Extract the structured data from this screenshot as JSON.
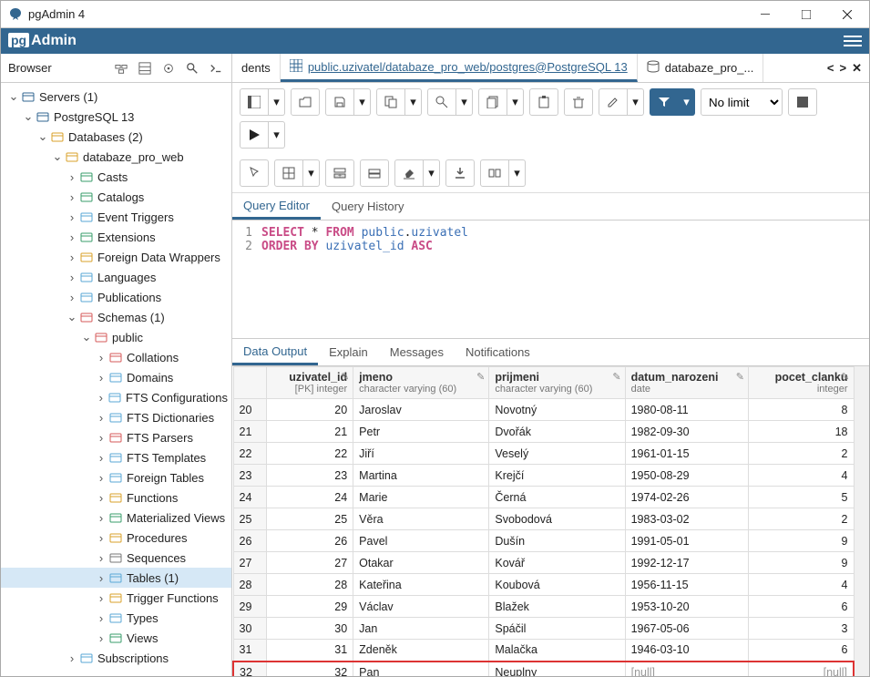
{
  "window": {
    "title": "pgAdmin 4"
  },
  "logo": {
    "box": "pg",
    "text": "Admin"
  },
  "browser": {
    "label": "Browser",
    "tree": [
      {
        "depth": 0,
        "caret": "down",
        "icon": "server-group",
        "color": "#326690",
        "label": "Servers (1)"
      },
      {
        "depth": 1,
        "caret": "down",
        "icon": "pg-elephant",
        "color": "#326690",
        "label": "PostgreSQL 13"
      },
      {
        "depth": 2,
        "caret": "down",
        "icon": "database-stack",
        "color": "#d9a02a",
        "label": "Databases (2)"
      },
      {
        "depth": 3,
        "caret": "down",
        "icon": "database",
        "color": "#d9a02a",
        "label": "databaze_pro_web"
      },
      {
        "depth": 4,
        "caret": "right",
        "icon": "casts",
        "color": "#3a9e6b",
        "label": "Casts"
      },
      {
        "depth": 4,
        "caret": "right",
        "icon": "catalogs",
        "color": "#3a9e6b",
        "label": "Catalogs"
      },
      {
        "depth": 4,
        "caret": "right",
        "icon": "event-triggers",
        "color": "#5aa7d6",
        "label": "Event Triggers"
      },
      {
        "depth": 4,
        "caret": "right",
        "icon": "extensions",
        "color": "#3a9e6b",
        "label": "Extensions"
      },
      {
        "depth": 4,
        "caret": "right",
        "icon": "fdw",
        "color": "#d9a02a",
        "label": "Foreign Data Wrappers"
      },
      {
        "depth": 4,
        "caret": "right",
        "icon": "languages",
        "color": "#5aa7d6",
        "label": "Languages"
      },
      {
        "depth": 4,
        "caret": "right",
        "icon": "publications",
        "color": "#5aa7d6",
        "label": "Publications"
      },
      {
        "depth": 4,
        "caret": "down",
        "icon": "schemas",
        "color": "#d65a5a",
        "label": "Schemas (1)"
      },
      {
        "depth": 5,
        "caret": "down",
        "icon": "schema",
        "color": "#d65a5a",
        "label": "public"
      },
      {
        "depth": 6,
        "caret": "right",
        "icon": "collations",
        "color": "#d65a5a",
        "label": "Collations"
      },
      {
        "depth": 6,
        "caret": "right",
        "icon": "domains",
        "color": "#5aa7d6",
        "label": "Domains"
      },
      {
        "depth": 6,
        "caret": "right",
        "icon": "fts-config",
        "color": "#5aa7d6",
        "label": "FTS Configurations"
      },
      {
        "depth": 6,
        "caret": "right",
        "icon": "fts-dict",
        "color": "#5aa7d6",
        "label": "FTS Dictionaries"
      },
      {
        "depth": 6,
        "caret": "right",
        "icon": "fts-parsers",
        "color": "#d65a5a",
        "label": "FTS Parsers"
      },
      {
        "depth": 6,
        "caret": "right",
        "icon": "fts-templates",
        "color": "#5aa7d6",
        "label": "FTS Templates"
      },
      {
        "depth": 6,
        "caret": "right",
        "icon": "foreign-tables",
        "color": "#5aa7d6",
        "label": "Foreign Tables"
      },
      {
        "depth": 6,
        "caret": "right",
        "icon": "functions",
        "color": "#d9a02a",
        "label": "Functions"
      },
      {
        "depth": 6,
        "caret": "right",
        "icon": "mat-views",
        "color": "#3a9e6b",
        "label": "Materialized Views"
      },
      {
        "depth": 6,
        "caret": "right",
        "icon": "procedures",
        "color": "#d9a02a",
        "label": "Procedures"
      },
      {
        "depth": 6,
        "caret": "right",
        "icon": "sequences",
        "color": "#777",
        "label": "Sequences"
      },
      {
        "depth": 6,
        "caret": "right",
        "icon": "tables",
        "color": "#5aa7d6",
        "label": "Tables (1)",
        "selected": true
      },
      {
        "depth": 6,
        "caret": "right",
        "icon": "trigger-funcs",
        "color": "#d9a02a",
        "label": "Trigger Functions"
      },
      {
        "depth": 6,
        "caret": "right",
        "icon": "types",
        "color": "#5aa7d6",
        "label": "Types"
      },
      {
        "depth": 6,
        "caret": "right",
        "icon": "views",
        "color": "#3a9e6b",
        "label": "Views"
      },
      {
        "depth": 4,
        "caret": "right",
        "icon": "subscriptions",
        "color": "#5aa7d6",
        "label": "Subscriptions"
      }
    ]
  },
  "tabs": {
    "prev": "dents",
    "active_full": "public.uzivatel/databaze_pro_web/postgres@PostgreSQL 13",
    "next": "databaze_pro_..."
  },
  "toolbar": {
    "nolimit": "No limit"
  },
  "query_tabs": {
    "editor": "Query Editor",
    "history": "Query History"
  },
  "sql": {
    "lines": [
      {
        "n": "1",
        "html": "<span class='kw'>SELECT</span> <span class='op'>*</span> <span class='kw'>FROM</span> <span class='id'>public</span><span class='op'>.</span><span class='tbl'>uzivatel</span>"
      },
      {
        "n": "2",
        "html": "<span class='kw'>ORDER BY</span> <span class='id'>uzivatel_id</span> <span class='kw'>ASC</span>"
      }
    ]
  },
  "result_tabs": {
    "data": "Data Output",
    "explain": "Explain",
    "messages": "Messages",
    "notifications": "Notifications"
  },
  "columns": [
    {
      "name": "uzivatel_id",
      "type": "[PK] integer",
      "num": true
    },
    {
      "name": "jmeno",
      "type": "character varying (60)",
      "num": false
    },
    {
      "name": "prijmeni",
      "type": "character varying (60)",
      "num": false
    },
    {
      "name": "datum_narozeni",
      "type": "date",
      "num": false
    },
    {
      "name": "pocet_clanku",
      "type": "integer",
      "num": true
    }
  ],
  "rows": [
    {
      "n": 20,
      "id": 20,
      "jmeno": "Jaroslav",
      "prijmeni": "Novotný",
      "datum": "1980-08-11",
      "pocet": "8"
    },
    {
      "n": 21,
      "id": 21,
      "jmeno": "Petr",
      "prijmeni": "Dvořák",
      "datum": "1982-09-30",
      "pocet": "18"
    },
    {
      "n": 22,
      "id": 22,
      "jmeno": "Jiří",
      "prijmeni": "Veselý",
      "datum": "1961-01-15",
      "pocet": "2"
    },
    {
      "n": 23,
      "id": 23,
      "jmeno": "Martina",
      "prijmeni": "Krejčí",
      "datum": "1950-08-29",
      "pocet": "4"
    },
    {
      "n": 24,
      "id": 24,
      "jmeno": "Marie",
      "prijmeni": "Černá",
      "datum": "1974-02-26",
      "pocet": "5"
    },
    {
      "n": 25,
      "id": 25,
      "jmeno": "Věra",
      "prijmeni": "Svobodová",
      "datum": "1983-03-02",
      "pocet": "2"
    },
    {
      "n": 26,
      "id": 26,
      "jmeno": "Pavel",
      "prijmeni": "Dušín",
      "datum": "1991-05-01",
      "pocet": "9"
    },
    {
      "n": 27,
      "id": 27,
      "jmeno": "Otakar",
      "prijmeni": "Kovář",
      "datum": "1992-12-17",
      "pocet": "9"
    },
    {
      "n": 28,
      "id": 28,
      "jmeno": "Kateřina",
      "prijmeni": "Koubová",
      "datum": "1956-11-15",
      "pocet": "4"
    },
    {
      "n": 29,
      "id": 29,
      "jmeno": "Václav",
      "prijmeni": "Blažek",
      "datum": "1953-10-20",
      "pocet": "6"
    },
    {
      "n": 30,
      "id": 30,
      "jmeno": "Jan",
      "prijmeni": "Spáčil",
      "datum": "1967-05-06",
      "pocet": "3"
    },
    {
      "n": 31,
      "id": 31,
      "jmeno": "Zdeněk",
      "prijmeni": "Malačka",
      "datum": "1946-03-10",
      "pocet": "6"
    },
    {
      "n": 32,
      "id": 32,
      "jmeno": "Pan",
      "prijmeni": "Neuplny",
      "datum": "[null]",
      "pocet": "[null]",
      "highlight": true
    }
  ]
}
